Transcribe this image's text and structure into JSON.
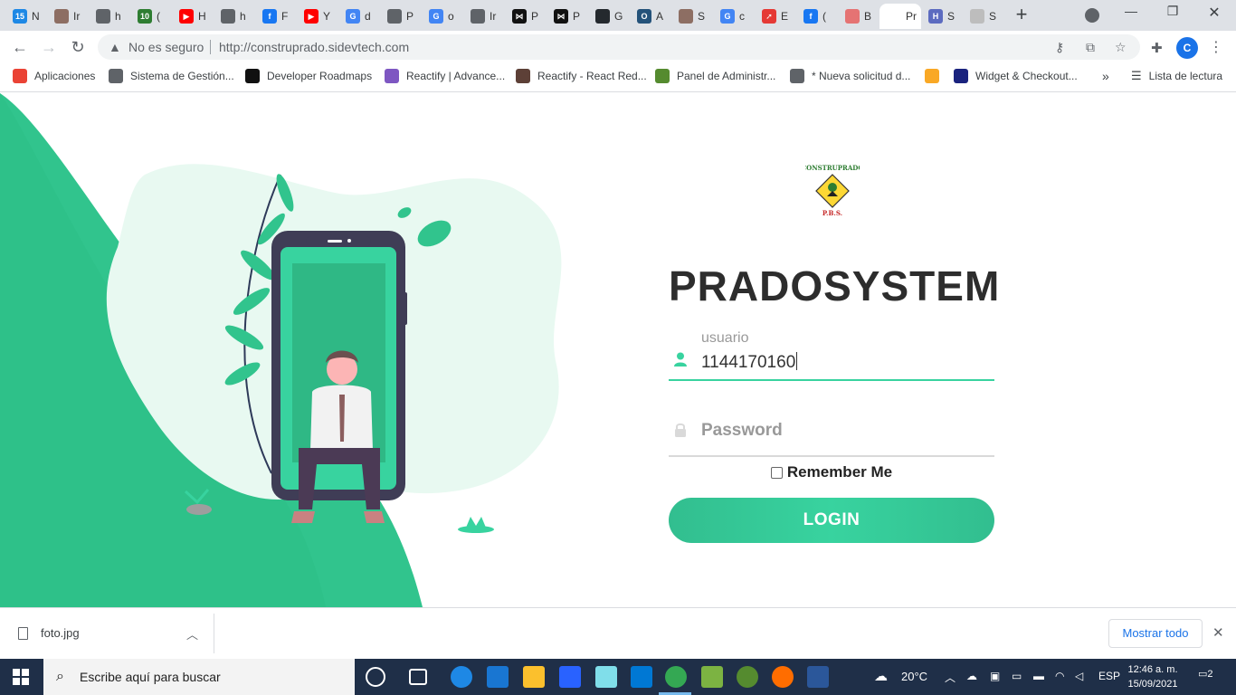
{
  "browser": {
    "tabs": [
      {
        "label": "N",
        "color": "#1e88e5",
        "glyph": "15"
      },
      {
        "label": "Ir",
        "color": "#8d6e63",
        "glyph": ""
      },
      {
        "label": "h",
        "color": "#5f6368",
        "glyph": ""
      },
      {
        "label": "(",
        "color": "#2e7d32",
        "glyph": "10"
      },
      {
        "label": "H",
        "color": "#ff0000",
        "glyph": "▶"
      },
      {
        "label": "h",
        "color": "#5f6368",
        "glyph": ""
      },
      {
        "label": "F",
        "color": "#1877f2",
        "glyph": "f"
      },
      {
        "label": "Y",
        "color": "#ff0000",
        "glyph": "▶"
      },
      {
        "label": "d",
        "color": "#4285f4",
        "glyph": "G"
      },
      {
        "label": "P",
        "color": "#5f6368",
        "glyph": ""
      },
      {
        "label": "o",
        "color": "#4285f4",
        "glyph": "G"
      },
      {
        "label": "Ir",
        "color": "#5f6368",
        "glyph": ""
      },
      {
        "label": "P",
        "color": "#111111",
        "glyph": "⋈"
      },
      {
        "label": "P",
        "color": "#111111",
        "glyph": "⋈"
      },
      {
        "label": "G",
        "color": "#24292e",
        "glyph": ""
      },
      {
        "label": "A",
        "color": "#24527a",
        "glyph": "O"
      },
      {
        "label": "S",
        "color": "#8d6e63",
        "glyph": ""
      },
      {
        "label": "c",
        "color": "#4285f4",
        "glyph": "G"
      },
      {
        "label": "E",
        "color": "#e53935",
        "glyph": "➚"
      },
      {
        "label": "(",
        "color": "#1877f2",
        "glyph": "f"
      },
      {
        "label": "B",
        "color": "#e57373",
        "glyph": ""
      },
      {
        "label": "Pr",
        "color": "#ffffff",
        "glyph": ""
      },
      {
        "label": "S",
        "color": "#5c6bc0",
        "glyph": "H"
      },
      {
        "label": "S",
        "color": "#bdbdbd",
        "glyph": ""
      }
    ],
    "active_tab_index": 21,
    "security_label": "No es seguro",
    "url": "http://construprado.sidevtech.com",
    "profile_initial": "C",
    "bookmarks": [
      {
        "label": "Aplicaciones",
        "color": "#ea4335"
      },
      {
        "label": "Sistema de Gestión...",
        "color": "#5f6368"
      },
      {
        "label": "Developer Roadmaps",
        "color": "#111111"
      },
      {
        "label": "Reactify | Advance...",
        "color": "#7e57c2"
      },
      {
        "label": "Reactify - React Red...",
        "color": "#5d4037"
      },
      {
        "label": "Panel de Administr...",
        "color": "#558b2f"
      },
      {
        "label": "* Nueva solicitud d...",
        "color": "#5f6368"
      },
      {
        "label": "",
        "color": "#f9a825"
      },
      {
        "label": "Widget & Checkout...",
        "color": "#1a237e"
      }
    ],
    "bookmarks_more": "»",
    "reading_list": "Lista de lectura"
  },
  "login": {
    "logo_text_top": "CONSTRUPRADO",
    "logo_text_bottom": "P.B.S.",
    "brand": "PRADOSYSTEM",
    "user_label": "usuario",
    "user_value": "1144170160",
    "password_placeholder": "Password",
    "remember_label": "Remember Me",
    "login_button": "LOGIN",
    "accent_color": "#38d39f"
  },
  "downloads": {
    "file_name": "foto.jpg",
    "show_all": "Mostrar todo"
  },
  "taskbar": {
    "search_placeholder": "Escribe aquí para buscar",
    "temperature": "20°C",
    "language": "ESP",
    "time": "12:46 a. m.",
    "date": "15/09/2021",
    "notifications": "2"
  }
}
